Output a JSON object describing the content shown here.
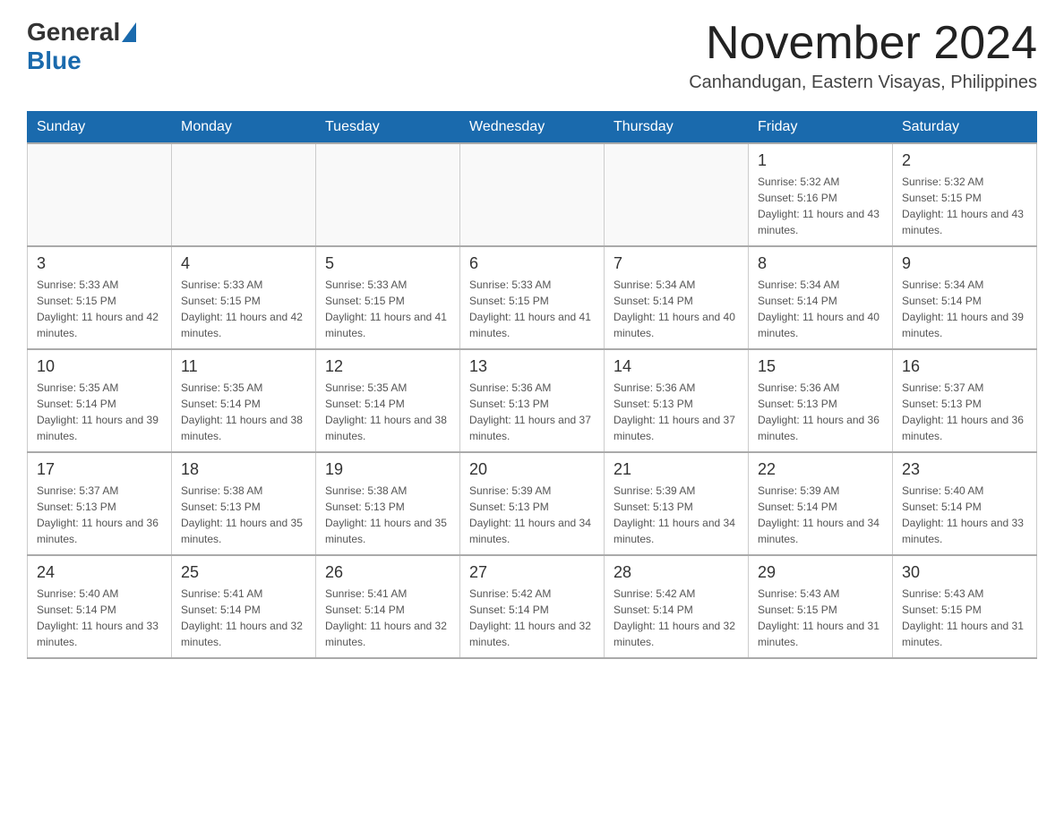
{
  "header": {
    "logo": {
      "general": "General",
      "blue": "Blue"
    },
    "title": "November 2024",
    "location": "Canhandugan, Eastern Visayas, Philippines"
  },
  "calendar": {
    "days_of_week": [
      "Sunday",
      "Monday",
      "Tuesday",
      "Wednesday",
      "Thursday",
      "Friday",
      "Saturday"
    ],
    "weeks": [
      [
        {
          "day": "",
          "info": ""
        },
        {
          "day": "",
          "info": ""
        },
        {
          "day": "",
          "info": ""
        },
        {
          "day": "",
          "info": ""
        },
        {
          "day": "",
          "info": ""
        },
        {
          "day": "1",
          "info": "Sunrise: 5:32 AM\nSunset: 5:16 PM\nDaylight: 11 hours and 43 minutes."
        },
        {
          "day": "2",
          "info": "Sunrise: 5:32 AM\nSunset: 5:15 PM\nDaylight: 11 hours and 43 minutes."
        }
      ],
      [
        {
          "day": "3",
          "info": "Sunrise: 5:33 AM\nSunset: 5:15 PM\nDaylight: 11 hours and 42 minutes."
        },
        {
          "day": "4",
          "info": "Sunrise: 5:33 AM\nSunset: 5:15 PM\nDaylight: 11 hours and 42 minutes."
        },
        {
          "day": "5",
          "info": "Sunrise: 5:33 AM\nSunset: 5:15 PM\nDaylight: 11 hours and 41 minutes."
        },
        {
          "day": "6",
          "info": "Sunrise: 5:33 AM\nSunset: 5:15 PM\nDaylight: 11 hours and 41 minutes."
        },
        {
          "day": "7",
          "info": "Sunrise: 5:34 AM\nSunset: 5:14 PM\nDaylight: 11 hours and 40 minutes."
        },
        {
          "day": "8",
          "info": "Sunrise: 5:34 AM\nSunset: 5:14 PM\nDaylight: 11 hours and 40 minutes."
        },
        {
          "day": "9",
          "info": "Sunrise: 5:34 AM\nSunset: 5:14 PM\nDaylight: 11 hours and 39 minutes."
        }
      ],
      [
        {
          "day": "10",
          "info": "Sunrise: 5:35 AM\nSunset: 5:14 PM\nDaylight: 11 hours and 39 minutes."
        },
        {
          "day": "11",
          "info": "Sunrise: 5:35 AM\nSunset: 5:14 PM\nDaylight: 11 hours and 38 minutes."
        },
        {
          "day": "12",
          "info": "Sunrise: 5:35 AM\nSunset: 5:14 PM\nDaylight: 11 hours and 38 minutes."
        },
        {
          "day": "13",
          "info": "Sunrise: 5:36 AM\nSunset: 5:13 PM\nDaylight: 11 hours and 37 minutes."
        },
        {
          "day": "14",
          "info": "Sunrise: 5:36 AM\nSunset: 5:13 PM\nDaylight: 11 hours and 37 minutes."
        },
        {
          "day": "15",
          "info": "Sunrise: 5:36 AM\nSunset: 5:13 PM\nDaylight: 11 hours and 36 minutes."
        },
        {
          "day": "16",
          "info": "Sunrise: 5:37 AM\nSunset: 5:13 PM\nDaylight: 11 hours and 36 minutes."
        }
      ],
      [
        {
          "day": "17",
          "info": "Sunrise: 5:37 AM\nSunset: 5:13 PM\nDaylight: 11 hours and 36 minutes."
        },
        {
          "day": "18",
          "info": "Sunrise: 5:38 AM\nSunset: 5:13 PM\nDaylight: 11 hours and 35 minutes."
        },
        {
          "day": "19",
          "info": "Sunrise: 5:38 AM\nSunset: 5:13 PM\nDaylight: 11 hours and 35 minutes."
        },
        {
          "day": "20",
          "info": "Sunrise: 5:39 AM\nSunset: 5:13 PM\nDaylight: 11 hours and 34 minutes."
        },
        {
          "day": "21",
          "info": "Sunrise: 5:39 AM\nSunset: 5:13 PM\nDaylight: 11 hours and 34 minutes."
        },
        {
          "day": "22",
          "info": "Sunrise: 5:39 AM\nSunset: 5:14 PM\nDaylight: 11 hours and 34 minutes."
        },
        {
          "day": "23",
          "info": "Sunrise: 5:40 AM\nSunset: 5:14 PM\nDaylight: 11 hours and 33 minutes."
        }
      ],
      [
        {
          "day": "24",
          "info": "Sunrise: 5:40 AM\nSunset: 5:14 PM\nDaylight: 11 hours and 33 minutes."
        },
        {
          "day": "25",
          "info": "Sunrise: 5:41 AM\nSunset: 5:14 PM\nDaylight: 11 hours and 32 minutes."
        },
        {
          "day": "26",
          "info": "Sunrise: 5:41 AM\nSunset: 5:14 PM\nDaylight: 11 hours and 32 minutes."
        },
        {
          "day": "27",
          "info": "Sunrise: 5:42 AM\nSunset: 5:14 PM\nDaylight: 11 hours and 32 minutes."
        },
        {
          "day": "28",
          "info": "Sunrise: 5:42 AM\nSunset: 5:14 PM\nDaylight: 11 hours and 32 minutes."
        },
        {
          "day": "29",
          "info": "Sunrise: 5:43 AM\nSunset: 5:15 PM\nDaylight: 11 hours and 31 minutes."
        },
        {
          "day": "30",
          "info": "Sunrise: 5:43 AM\nSunset: 5:15 PM\nDaylight: 11 hours and 31 minutes."
        }
      ]
    ]
  }
}
